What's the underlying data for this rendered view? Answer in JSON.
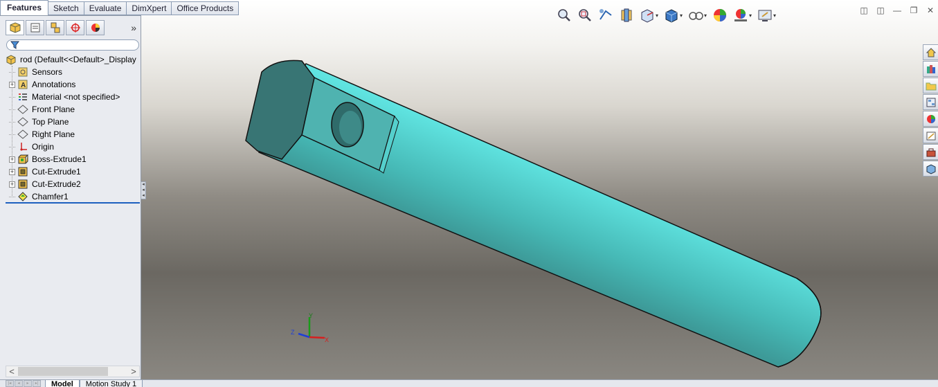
{
  "command_tabs": [
    "Features",
    "Sketch",
    "Evaluate",
    "DimXpert",
    "Office Products"
  ],
  "active_command_tab": "Features",
  "panel": {
    "tab_icons": [
      "feature-manager-icon",
      "property-manager-icon",
      "configuration-manager-icon",
      "dimxpert-manager-icon",
      "display-manager-icon"
    ],
    "more_label": "»"
  },
  "tree": {
    "root": "rod  (Default<<Default>_Display",
    "items": [
      {
        "label": "Sensors",
        "icon": "sensors-icon",
        "expandable": false
      },
      {
        "label": "Annotations",
        "icon": "annotations-icon",
        "expandable": true
      },
      {
        "label": "Material <not specified>",
        "icon": "material-icon",
        "expandable": false
      },
      {
        "label": "Front Plane",
        "icon": "plane-icon",
        "expandable": false
      },
      {
        "label": "Top Plane",
        "icon": "plane-icon",
        "expandable": false
      },
      {
        "label": "Right Plane",
        "icon": "plane-icon",
        "expandable": false
      },
      {
        "label": "Origin",
        "icon": "origin-icon",
        "expandable": false
      },
      {
        "label": "Boss-Extrude1",
        "icon": "boss-extrude-icon",
        "expandable": true
      },
      {
        "label": "Cut-Extrude1",
        "icon": "cut-extrude-icon",
        "expandable": true
      },
      {
        "label": "Cut-Extrude2",
        "icon": "cut-extrude-icon",
        "expandable": true
      },
      {
        "label": "Chamfer1",
        "icon": "chamfer-icon",
        "expandable": false
      }
    ]
  },
  "scroll_left": "<",
  "scroll_right": ">",
  "expand_glyph": "+",
  "hud_icons": [
    "zoom-to-fit-icon",
    "zoom-to-area-icon",
    "previous-view-icon",
    "section-view-icon",
    "view-orientation-icon",
    "display-style-icon",
    "hide-show-items-icon",
    "edit-appearance-icon",
    "apply-scene-icon",
    "view-settings-icon"
  ],
  "window_controls": {
    "tile_left": "◫",
    "tile_right": "◫",
    "minimize": "—",
    "restore": "❐",
    "close": "✕"
  },
  "task_pane_icons": [
    "solidworks-resources-icon",
    "design-library-icon",
    "file-explorer-icon",
    "view-palette-icon",
    "appearances-icon",
    "custom-properties-icon",
    "toolbox-icon",
    "3d-content-icon"
  ],
  "triad": {
    "x": "X",
    "y": "Y",
    "z": "Z"
  },
  "colors": {
    "model_face": "#5fe3e0",
    "model_dark": "#3a6f6e",
    "accent": "#1c5fbf"
  },
  "bottom_tabs": [
    "Model",
    "Motion Study 1"
  ],
  "active_bottom_tab": "Model"
}
